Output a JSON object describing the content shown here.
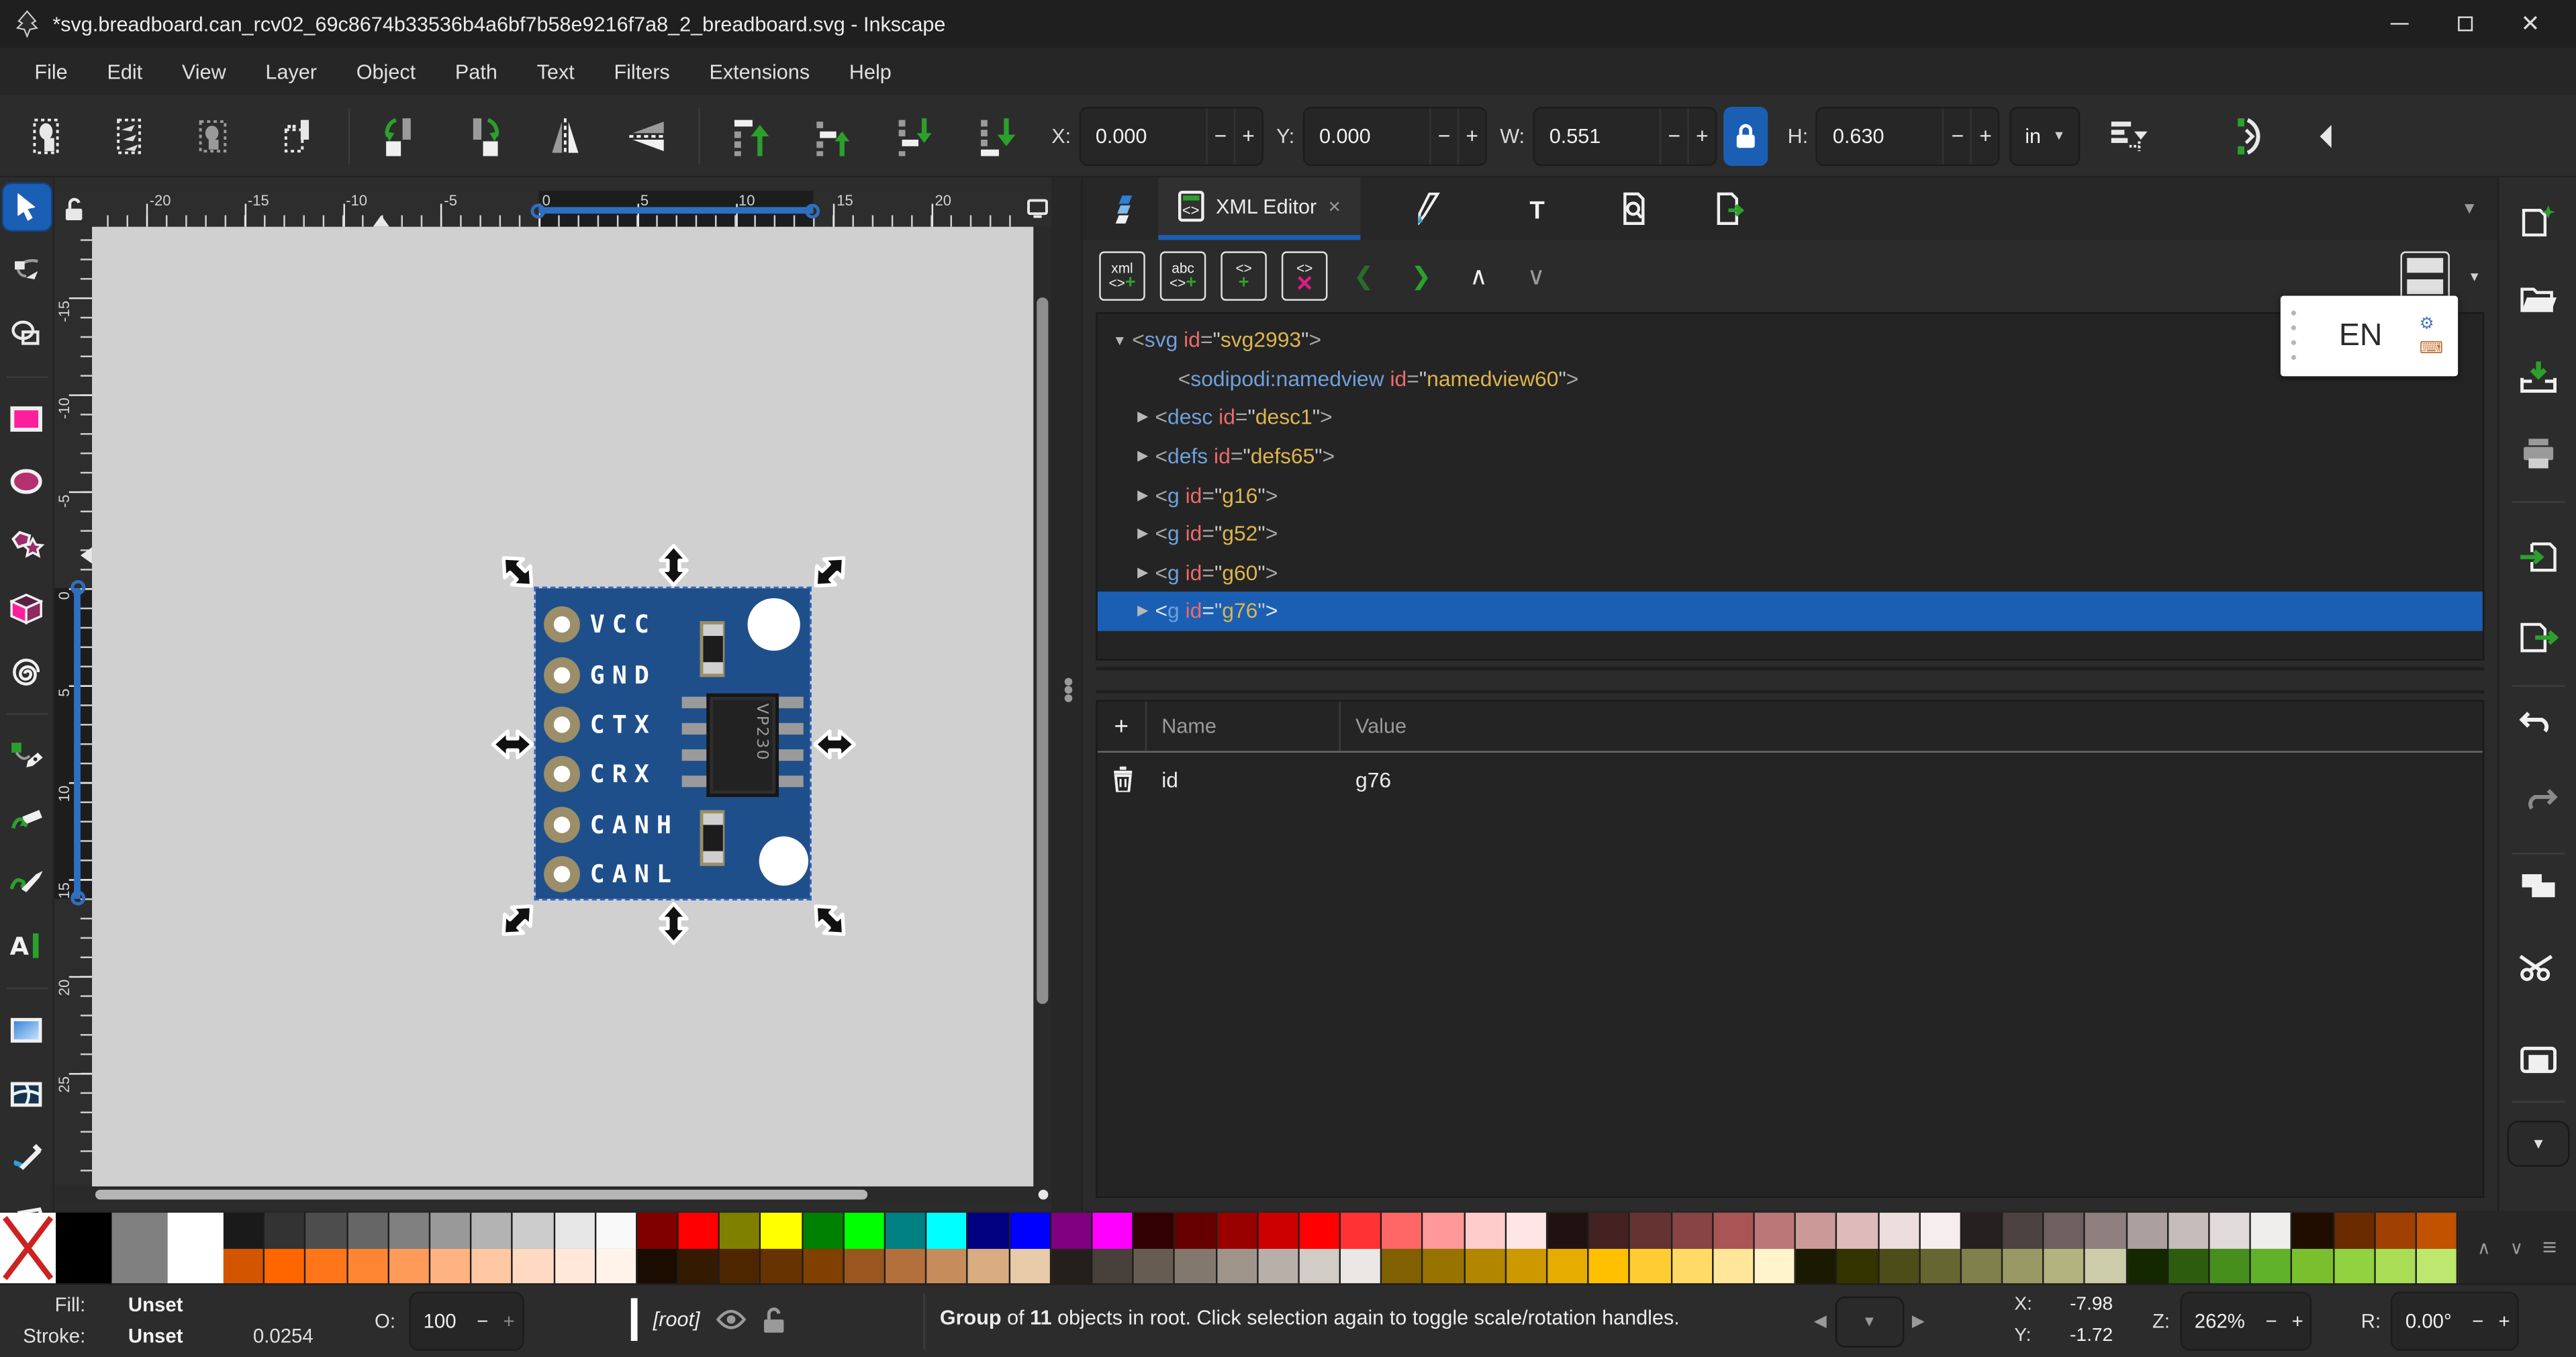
{
  "window": {
    "title": "*svg.breadboard.can_rcv02_69c8674b33536b4a6bf7b58e9216f7a8_2_breadboard.svg - Inkscape",
    "close_glyph": "✕"
  },
  "menubar": {
    "items": [
      "File",
      "Edit",
      "View",
      "Layer",
      "Object",
      "Path",
      "Text",
      "Filters",
      "Extensions",
      "Help"
    ]
  },
  "toolbar": {
    "x_label": "X:",
    "x_value": "0.000",
    "y_label": "Y:",
    "y_value": "0.000",
    "w_label": "W:",
    "w_value": "0.551",
    "h_label": "H:",
    "h_value": "0.630",
    "minus": "−",
    "plus": "+",
    "unit": "in",
    "accent_color": "#1a5fb4"
  },
  "dock": {
    "xml_tab_label": "XML Editor",
    "xml_tab_close": "×",
    "collapse_chevron": "▼",
    "keyboard_indicator": "EN",
    "new_element_label": "xml",
    "new_text_label": "abc",
    "node_glyph": "<>",
    "plus": "+",
    "delete_x": "✕",
    "unindent_glyph": "❮",
    "indent_glyph": "❯",
    "up_glyph": "∧",
    "down_glyph": "∨",
    "xml_tree": {
      "rows": [
        {
          "expander": "▼",
          "tag": "svg",
          "attr": "id",
          "value": "svg2993",
          "pad": "6px",
          "sel": ""
        },
        {
          "expander": "",
          "tag": "sodipodi:namedview",
          "attr": "id",
          "value": "namedview60",
          "pad": "34px",
          "sel": ""
        },
        {
          "expander": "▶",
          "tag": "desc",
          "attr": "id",
          "value": "desc1",
          "pad": "20px",
          "sel": ""
        },
        {
          "expander": "▶",
          "tag": "defs",
          "attr": "id",
          "value": "defs65",
          "pad": "20px",
          "sel": ""
        },
        {
          "expander": "▶",
          "tag": "g",
          "attr": "id",
          "value": "g16",
          "pad": "20px",
          "sel": ""
        },
        {
          "expander": "▶",
          "tag": "g",
          "attr": "id",
          "value": "g52",
          "pad": "20px",
          "sel": ""
        },
        {
          "expander": "▶",
          "tag": "g",
          "attr": "id",
          "value": "g60",
          "pad": "20px",
          "sel": ""
        },
        {
          "expander": "▶",
          "tag": "g",
          "attr": "id",
          "value": "g76",
          "pad": "20px",
          "sel": "selected"
        }
      ]
    },
    "attributes": {
      "name_header": "Name",
      "value_header": "Value",
      "add_label": "+",
      "rows": [
        {
          "name": "id",
          "value": "g76"
        }
      ]
    }
  },
  "canvas": {
    "h_ruler_labels": [
      {
        "v": -20,
        "t": "-20"
      },
      {
        "v": -15,
        "t": "-15"
      },
      {
        "v": -10,
        "t": "-10"
      },
      {
        "v": -5,
        "t": "-5"
      },
      {
        "v": 0,
        "t": "0"
      },
      {
        "v": 5,
        "t": "5"
      },
      {
        "v": 10,
        "t": "10"
      },
      {
        "v": 15,
        "t": "15"
      },
      {
        "v": 20,
        "t": "20"
      }
    ],
    "v_ruler_labels": [
      {
        "v": -15,
        "t": "-15"
      },
      {
        "v": -10,
        "t": "-10"
      },
      {
        "v": -5,
        "t": "-5"
      },
      {
        "v": 0,
        "t": "0"
      },
      {
        "v": 5,
        "t": "5"
      },
      {
        "v": 10,
        "t": "10"
      },
      {
        "v": 15,
        "t": "15"
      },
      {
        "v": 20,
        "t": "20"
      },
      {
        "v": 25,
        "t": "25"
      }
    ],
    "breadboard": {
      "pins": [
        "VCC",
        "GND",
        "CTX",
        "CRX",
        "CANH",
        "CANL"
      ],
      "chip_label": "VP230",
      "pcb_color": "#1f4f8b",
      "pad_ring_color": "#9b8e68"
    }
  },
  "palette": {
    "big": [
      "#000000",
      "#808080",
      "#ffffff"
    ],
    "row1": [
      "#1a1a1a",
      "#333333",
      "#4d4d4d",
      "#666666",
      "#808080",
      "#999999",
      "#b3b3b3",
      "#cccccc",
      "#e6e6e6",
      "#f9f9f9",
      "#800000",
      "#ff0000",
      "#808000",
      "#ffff00",
      "#008000",
      "#00ff00",
      "#008080",
      "#00ffff",
      "#000080",
      "#0000ff",
      "#800080",
      "#ff00ff",
      "#330000",
      "#660000",
      "#990000",
      "#cc0000",
      "#ff0000",
      "#ff3333",
      "#ff6666",
      "#ff9999",
      "#ffcccc",
      "#ffe6e6",
      "#221111",
      "#442222",
      "#663333",
      "#884444",
      "#aa5555",
      "#bb7777",
      "#cc9999",
      "#ddbbbb",
      "#eedddd",
      "#f6eeee",
      "#262020",
      "#4c4242",
      "#6e6060",
      "#8f7f7f",
      "#ab9f9f",
      "#c6bcbc",
      "#e0dada",
      "#f0eded",
      "#200d00",
      "#6b2b00",
      "#a04000",
      "#c05200"
    ],
    "row2": [
      "#d45500",
      "#ff6600",
      "#ff751a",
      "#ff8533",
      "#ff9b59",
      "#ffb380",
      "#ffc8a3",
      "#ffd9c2",
      "#ffe8d9",
      "#fff3ea",
      "#1a0d00",
      "#331a00",
      "#4d2600",
      "#663300",
      "#804000",
      "#99571f",
      "#b3703d",
      "#c68c5c",
      "#d9ab80",
      "#e8cba8",
      "#241f1a",
      "#47403a",
      "#665c52",
      "#83786d",
      "#9e948a",
      "#b8b0a8",
      "#d2ccc6",
      "#eae7e4",
      "#806000",
      "#997300",
      "#b38600",
      "#cc9900",
      "#e6ad00",
      "#ffc000",
      "#ffcd33",
      "#ffda66",
      "#ffe799",
      "#fff4cc",
      "#1a1a00",
      "#333300",
      "#4d4d1a",
      "#666633",
      "#80804d",
      "#999966",
      "#b3b380",
      "#ccccaa",
      "#142800",
      "#2d5c0e",
      "#478f1c",
      "#61b22b",
      "#7ac02e",
      "#92d13f",
      "#a8dd55",
      "#bde76e"
    ],
    "scroll_up": "∧",
    "scroll_down": "∨",
    "menu": "≡"
  },
  "statusbar": {
    "fill_label": "Fill:",
    "fill_value": "Unset",
    "stroke_label": "Stroke:",
    "stroke_value": "Unset",
    "stroke_width": "0.0254",
    "opacity_label": "O:",
    "opacity_value": "100",
    "minus": "−",
    "plus": "+",
    "layer_indicator": "[root]",
    "message_bold1": "Group",
    "message_mid": " of ",
    "message_bold2": "11",
    "message_rest": " objects in root. Click selection again to toggle scale/rotation handles.",
    "prev_glyph": "◀",
    "drop_glyph": "▼",
    "next_glyph": "▶",
    "x_label": "X:",
    "x_value": "-7.98",
    "y_label": "Y:",
    "y_value": "-1.72",
    "zoom_label": "Z:",
    "zoom_value": "262%",
    "rotation_label": "R:",
    "rotation_value": "0.00°"
  }
}
